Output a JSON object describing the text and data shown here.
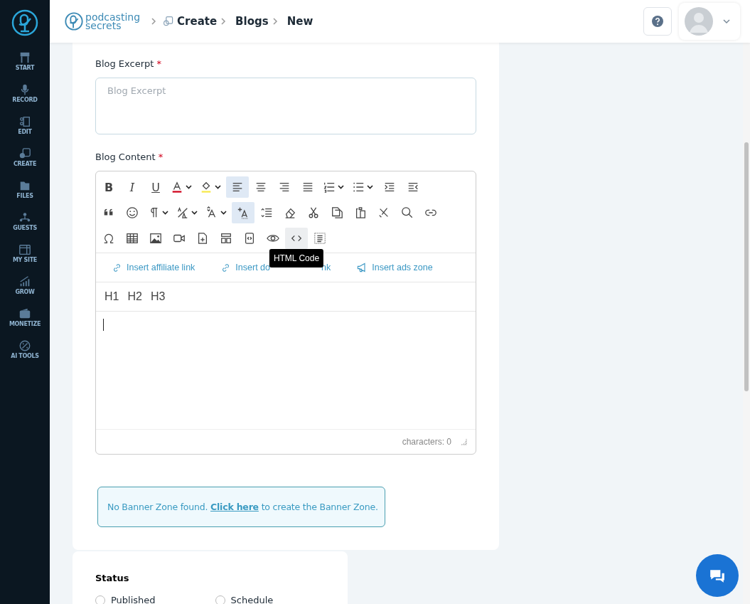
{
  "sidebar": {
    "items": [
      {
        "label": "START"
      },
      {
        "label": "RECORD"
      },
      {
        "label": "EDIT"
      },
      {
        "label": "CREATE"
      },
      {
        "label": "FILES"
      },
      {
        "label": "GUESTS"
      },
      {
        "label": "MY SITE"
      },
      {
        "label": "GROW"
      },
      {
        "label": "MONETIZE"
      },
      {
        "label": "AI TOOLS"
      }
    ]
  },
  "header": {
    "logo_lines": [
      "podcasting",
      "secrets"
    ],
    "breadcrumb": [
      "Create",
      "Blogs",
      "New"
    ]
  },
  "form": {
    "excerpt": {
      "label": "Blog Excerpt",
      "required_mark": "*",
      "placeholder": "Blog Excerpt"
    },
    "content": {
      "label": "Blog Content",
      "required_mark": "*",
      "toolbar": [
        [
          {
            "label": "B",
            "selected": false,
            "dropdown": false
          },
          {
            "label": "I",
            "selected": false,
            "dropdown": false
          },
          {
            "label": "U",
            "selected": false,
            "dropdown": false
          },
          {
            "selected": false,
            "dropdown": true
          },
          {
            "selected": false,
            "dropdown": true
          },
          {
            "selected": true,
            "dropdown": false
          },
          {
            "selected": false,
            "dropdown": false
          },
          {
            "selected": false,
            "dropdown": false
          },
          {
            "selected": false,
            "dropdown": false
          },
          {
            "selected": false,
            "dropdown": true
          },
          {
            "selected": false,
            "dropdown": true
          },
          {
            "selected": false,
            "dropdown": false
          },
          {
            "selected": false,
            "dropdown": false
          }
        ],
        [
          {
            "selected": false,
            "dropdown": false
          },
          {
            "selected": false,
            "dropdown": false
          },
          {
            "selected": false,
            "dropdown": true
          },
          {
            "selected": false,
            "dropdown": true
          },
          {
            "selected": false,
            "dropdown": true
          },
          {
            "selected": true,
            "dropdown": false
          },
          {
            "selected": false,
            "dropdown": false
          },
          {
            "selected": false,
            "dropdown": false
          },
          {
            "selected": false,
            "dropdown": false
          },
          {
            "selected": false,
            "dropdown": false
          },
          {
            "selected": false,
            "dropdown": false
          },
          {
            "selected": false,
            "dropdown": false
          },
          {
            "selected": false,
            "dropdown": false
          },
          {
            "selected": false,
            "dropdown": false
          }
        ],
        [
          {
            "selected": false,
            "dropdown": false
          },
          {
            "selected": false,
            "dropdown": false
          },
          {
            "selected": false,
            "dropdown": false
          },
          {
            "selected": false,
            "dropdown": false
          },
          {
            "selected": false,
            "dropdown": false
          },
          {
            "selected": false,
            "dropdown": false
          },
          {
            "selected": false,
            "dropdown": false
          },
          {
            "selected": false,
            "dropdown": false
          },
          {
            "selected": false,
            "dropdown": false,
            "hovered": true,
            "tooltip": "HTML Code"
          },
          {
            "selected": false,
            "dropdown": false
          }
        ]
      ],
      "insert_links": [
        {
          "label": "Insert affiliate link",
          "kind": "link"
        },
        {
          "label": "Insert do",
          "tail": "nk",
          "kind": "link"
        },
        {
          "label": "Insert ads zone",
          "kind": "megaphone"
        }
      ],
      "headings": [
        "H1",
        "H2",
        "H3"
      ],
      "counter": "characters: 0"
    },
    "banner_notice": {
      "text": "No Banner Zone found. ",
      "link": "Click here",
      "after": " to create the Banner Zone."
    }
  },
  "status": {
    "label": "Status",
    "options": [
      {
        "label": "Published",
        "selected": false
      },
      {
        "label": "Schedule",
        "selected": false
      }
    ]
  }
}
